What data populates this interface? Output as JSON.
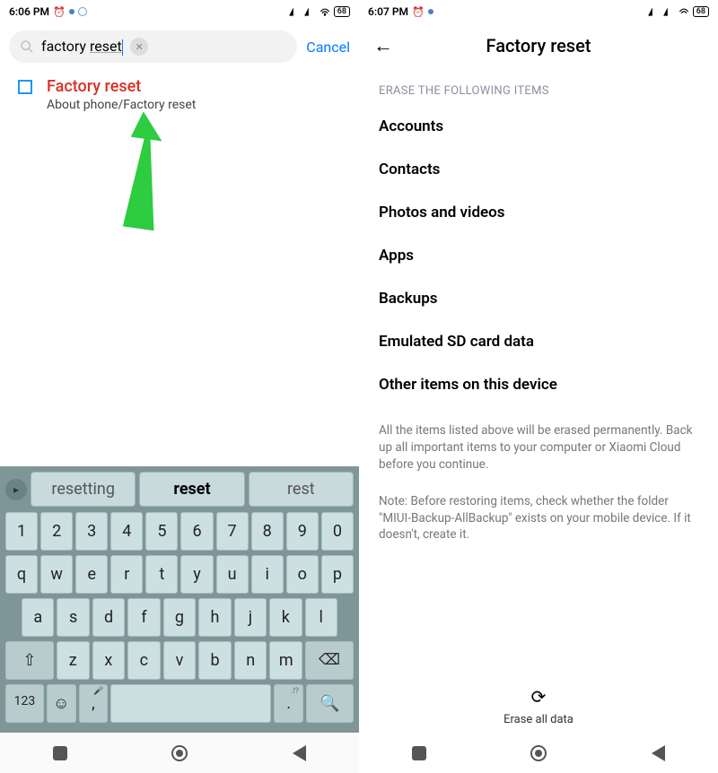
{
  "left": {
    "status": {
      "time": "6:06 PM",
      "battery": "68"
    },
    "search": {
      "value_pre": "factory ",
      "value_underlined": "reset",
      "cancel": "Cancel"
    },
    "result": {
      "title": "Factory reset",
      "sub": "About phone/Factory reset"
    },
    "suggestions": {
      "a": "resetting",
      "b": "reset",
      "c": "rest"
    },
    "keys": {
      "row1": [
        "1",
        "2",
        "3",
        "4",
        "5",
        "6",
        "7",
        "8",
        "9",
        "0"
      ],
      "row2": [
        "q",
        "w",
        "e",
        "r",
        "t",
        "y",
        "u",
        "i",
        "o",
        "p"
      ],
      "row3": [
        "a",
        "s",
        "d",
        "f",
        "g",
        "h",
        "j",
        "k",
        "l"
      ],
      "row4": [
        "z",
        "x",
        "c",
        "v",
        "b",
        "n",
        "m"
      ],
      "k123": "123",
      "comma": ",",
      "period": "."
    }
  },
  "right": {
    "status": {
      "time": "6:07 PM",
      "battery": "68"
    },
    "title": "Factory reset",
    "section": "ERASE THE FOLLOWING ITEMS",
    "items": [
      "Accounts",
      "Contacts",
      "Photos and videos",
      "Apps",
      "Backups",
      "Emulated SD card data",
      "Other items on this device"
    ],
    "info1": "All the items listed above will be erased permanently. Back up all important items to your computer or Xiaomi Cloud before you continue.",
    "info2": "Note: Before restoring items, check whether the folder \"MIUI-Backup-AllBackup\" exists on your mobile device. If it doesn't, create it.",
    "erase": "Erase all data"
  }
}
